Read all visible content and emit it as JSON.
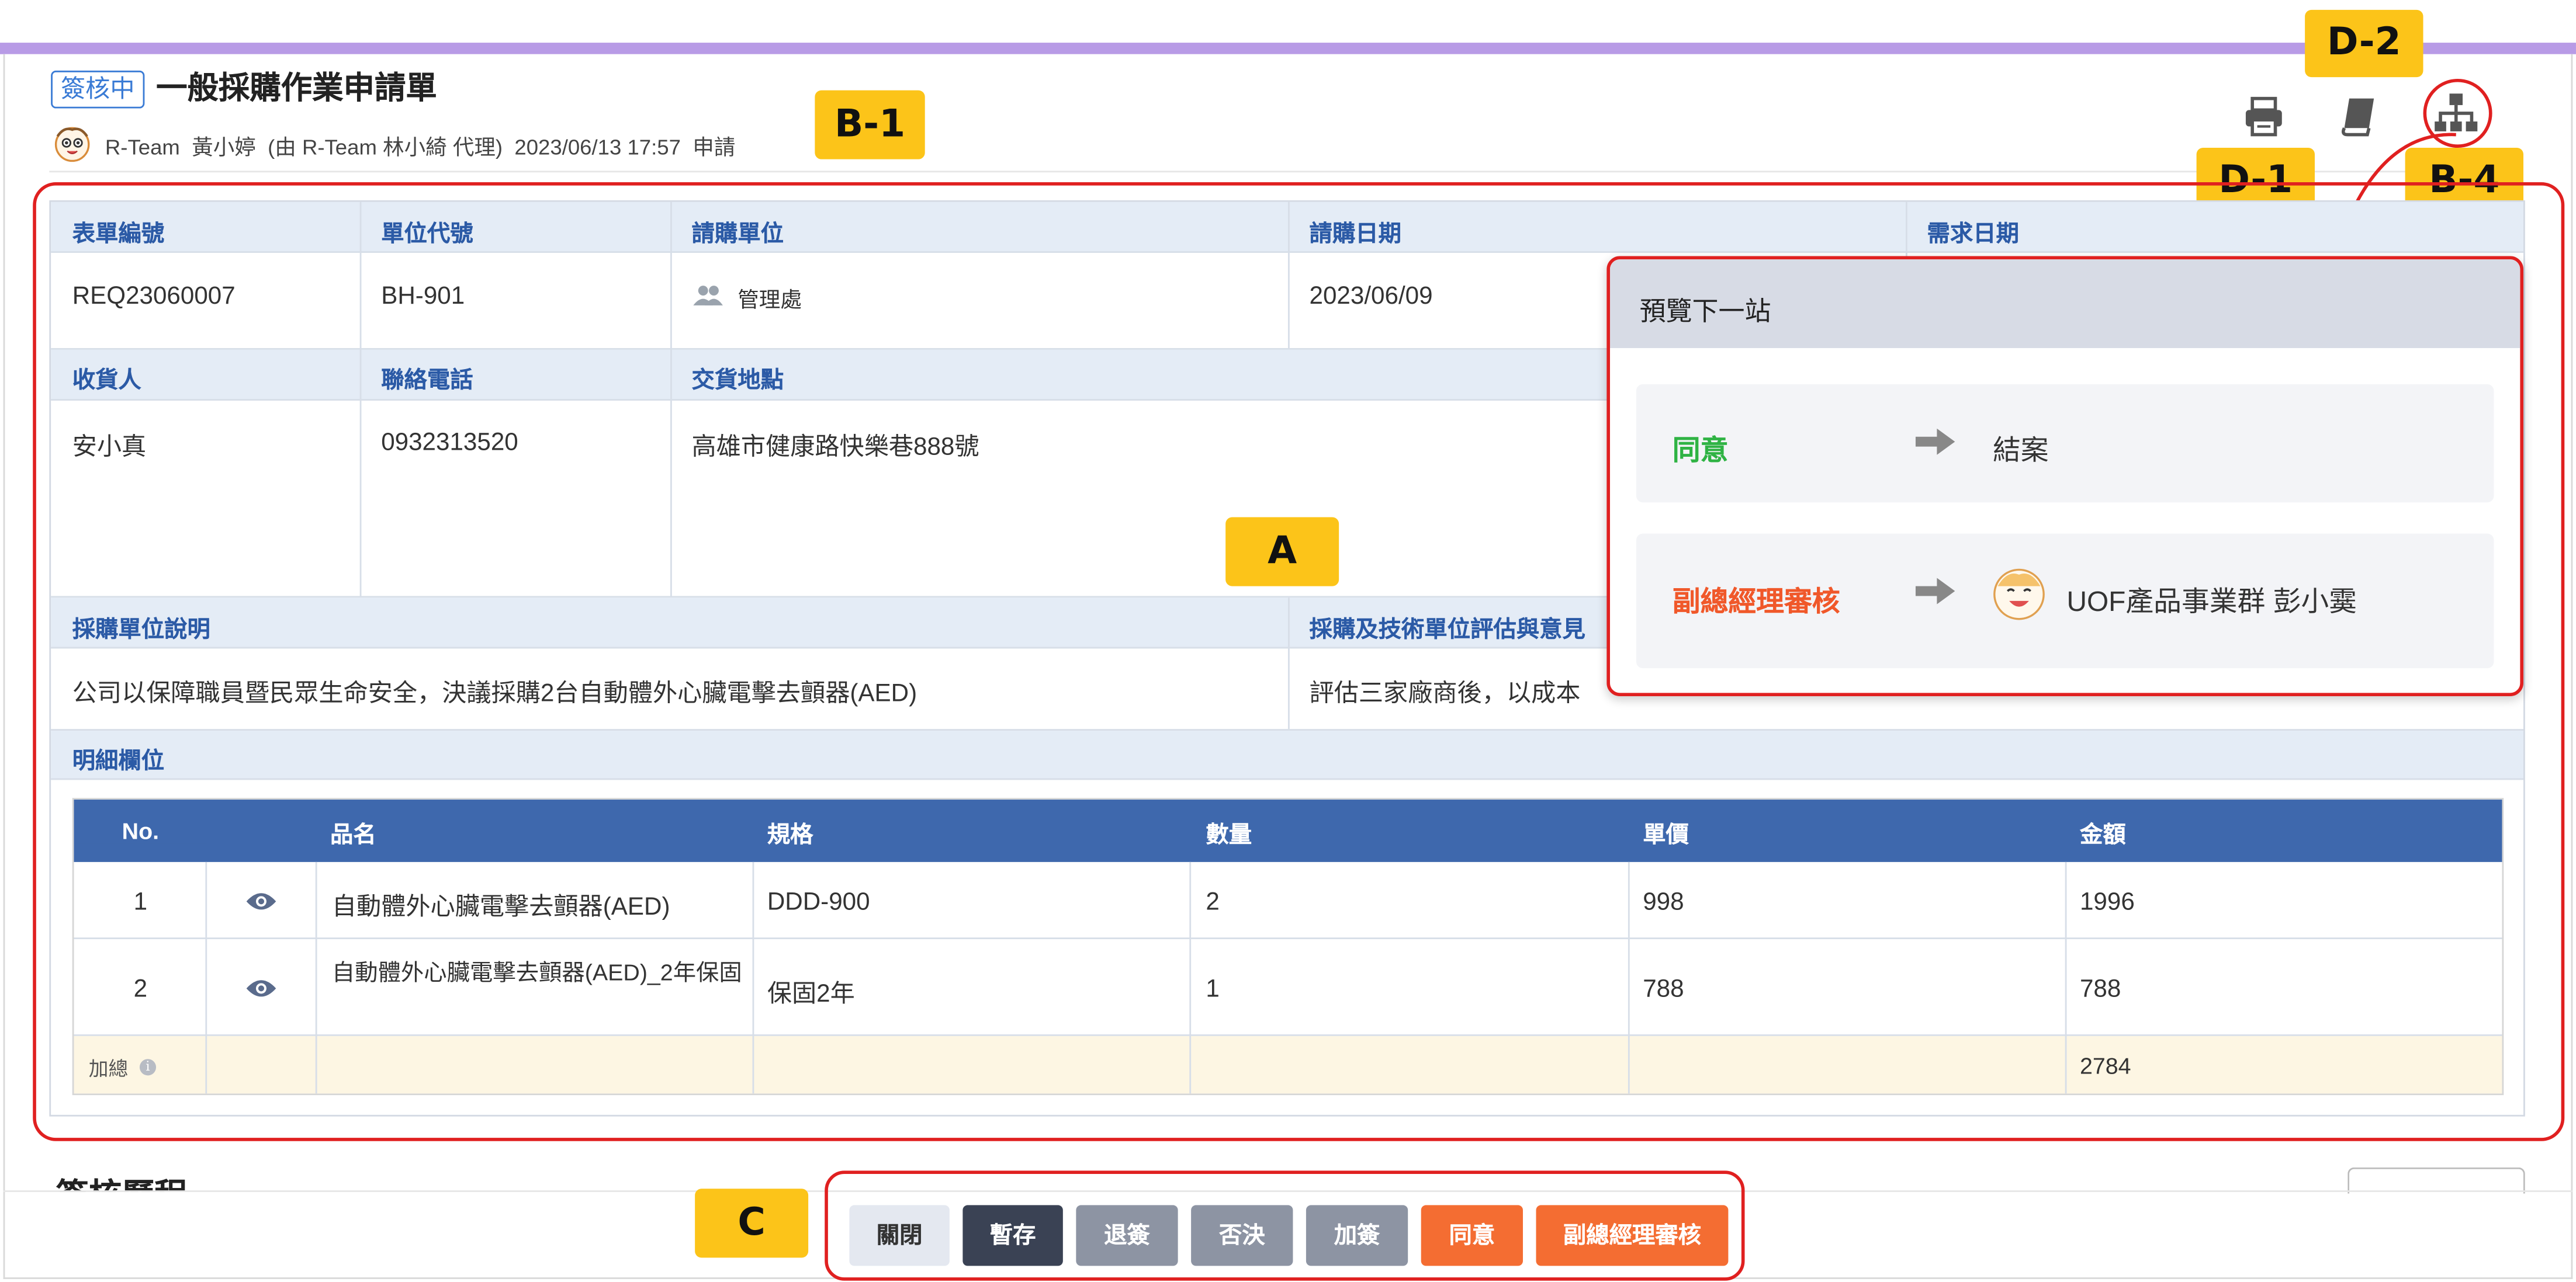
{
  "header": {
    "status": "簽核中",
    "title": "一般採購作業申請單",
    "applicant_line": "R-Team  黃小婷  (由 R-Team 林小綺 代理)  2023/06/13 17:57  申請"
  },
  "toolbar": {
    "print_icon": "printer-icon",
    "manual_icon": "book-icon",
    "flow_icon": "org-chart-icon"
  },
  "callouts": {
    "b1": "B-1",
    "d2": "D-2",
    "d1": "D-1",
    "b4": "B-4",
    "a": "A",
    "c": "C"
  },
  "form": {
    "row1": {
      "labels": [
        "表單編號",
        "單位代號",
        "請購單位",
        "請購日期",
        "需求日期"
      ],
      "form_no": "REQ23060007",
      "unit_code": "BH-901",
      "dept": "管理處",
      "req_date": "2023/06/09"
    },
    "row2": {
      "labels": [
        "收貨人",
        "聯絡電話",
        "交貨地點"
      ],
      "receiver": "安小真",
      "phone": "0932313520",
      "location": "高雄市健康路快樂巷888號"
    },
    "row3": {
      "labels": [
        "採購單位說明",
        "採購及技術單位評估與意見"
      ],
      "desc": "公司以保障職員暨民眾生命安全，決議採購2台自動體外心臟電擊去顫器(AED)",
      "eval": "評估三家廠商後，以成本"
    },
    "detail_label": "明細欄位"
  },
  "detail_table": {
    "headers": [
      "No.",
      "",
      "品名",
      "規格",
      "數量",
      "單價",
      "金額"
    ],
    "rows": [
      {
        "no": "1",
        "name": "自動體外心臟電擊去顫器(AED)",
        "spec": "DDD-900",
        "qty": "2",
        "price": "998",
        "amount": "1996"
      },
      {
        "no": "2",
        "name": "自動體外心臟電擊去顫器(AED)_2年保固",
        "spec": "保固2年",
        "qty": "1",
        "price": "788",
        "amount": "788"
      }
    ],
    "total_label": "加總",
    "total_amount": "2784"
  },
  "flow_preview": {
    "title": "預覽下一站",
    "options": [
      {
        "action": "同意",
        "target": "結案",
        "color": "#2fb344"
      },
      {
        "action": "副總經理審核",
        "target": "UOF產品事業群 彭小霙",
        "color": "#f0582a"
      }
    ]
  },
  "section_partial": "簽核歷程",
  "buttons": {
    "close": "關閉",
    "save": "暫存",
    "return": "退簽",
    "reject": "否決",
    "add_sign": "加簽",
    "agree": "同意",
    "vp_review": "副總經理審核"
  }
}
